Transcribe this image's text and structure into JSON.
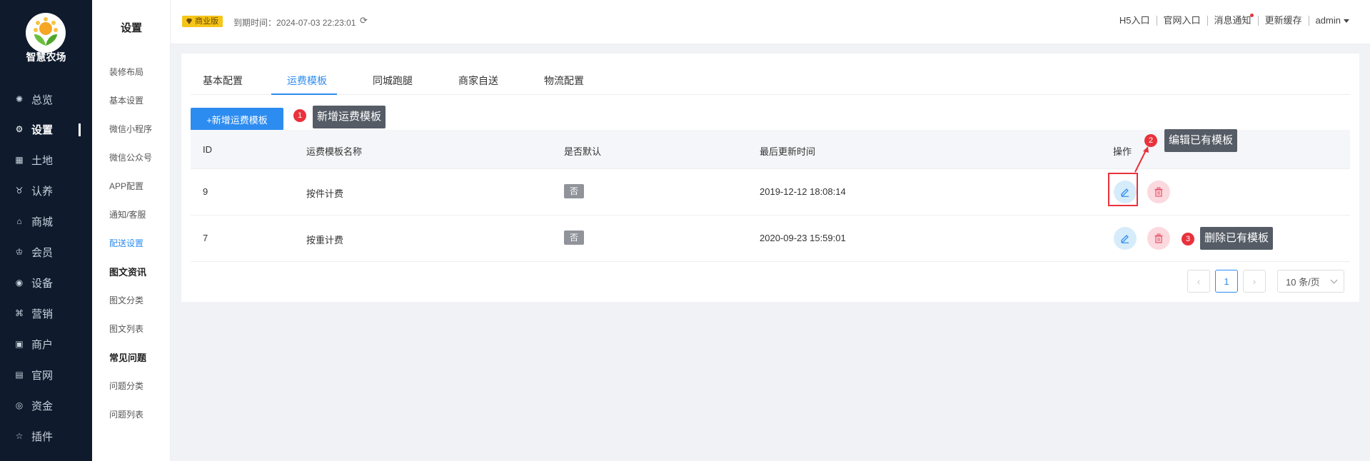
{
  "app": {
    "name": "智慧农场"
  },
  "nav": {
    "items": [
      {
        "label": "总览",
        "icon": "dashboard-icon"
      },
      {
        "label": "设置",
        "icon": "settings-icon",
        "active": true
      },
      {
        "label": "土地",
        "icon": "grid-icon"
      },
      {
        "label": "认养",
        "icon": "adopt-icon"
      },
      {
        "label": "商城",
        "icon": "shop-icon"
      },
      {
        "label": "会员",
        "icon": "member-icon"
      },
      {
        "label": "设备",
        "icon": "device-icon"
      },
      {
        "label": "营销",
        "icon": "marketing-icon"
      },
      {
        "label": "商户",
        "icon": "merchant-icon"
      },
      {
        "label": "官网",
        "icon": "website-icon"
      },
      {
        "label": "资金",
        "icon": "fund-icon"
      },
      {
        "label": "插件",
        "icon": "plugin-icon"
      }
    ]
  },
  "subnav": {
    "title": "设置",
    "items": [
      "装修布局",
      "基本设置",
      "微信小程序",
      "微信公众号",
      "APP配置",
      "通知/客服",
      "配送设置"
    ],
    "active_label": "配送设置",
    "groups": [
      {
        "heading": "图文资讯",
        "items": [
          "图文分类",
          "图文列表"
        ]
      },
      {
        "heading": "常见问题",
        "items": [
          "问题分类",
          "问题列表"
        ]
      }
    ]
  },
  "topbar": {
    "edition": "商业版",
    "expire": "到期时间：2024-07-03 22:23:01",
    "links": [
      "H5入口",
      "官网入口",
      "消息通知",
      "更新缓存"
    ],
    "user": "admin"
  },
  "tabs": [
    "基本配置",
    "运费模板",
    "同城跑腿",
    "商家自送",
    "物流配置"
  ],
  "active_tab": "运费模板",
  "toolbar": {
    "add_label": "+新增运费模板"
  },
  "annotations": [
    {
      "num": "1",
      "text": "新增运费模板"
    },
    {
      "num": "2",
      "text": "编辑已有模板"
    },
    {
      "num": "3",
      "text": "删除已有模板"
    }
  ],
  "table": {
    "columns": [
      "ID",
      "运费模板名称",
      "是否默认",
      "最后更新时间",
      "操作"
    ],
    "rows": [
      {
        "id": "9",
        "name": "按件计费",
        "default": "否",
        "updated": "2019-12-12 18:08:14"
      },
      {
        "id": "7",
        "name": "按重计费",
        "default": "否",
        "updated": "2020-09-23 15:59:01"
      }
    ]
  },
  "pagination": {
    "current": "1",
    "page_size": "10 条/页"
  },
  "colors": {
    "primary": "#2d8cf0",
    "nav_bg": "#0f1b2d",
    "danger": "#e8323c",
    "badge": "#f5c518"
  }
}
